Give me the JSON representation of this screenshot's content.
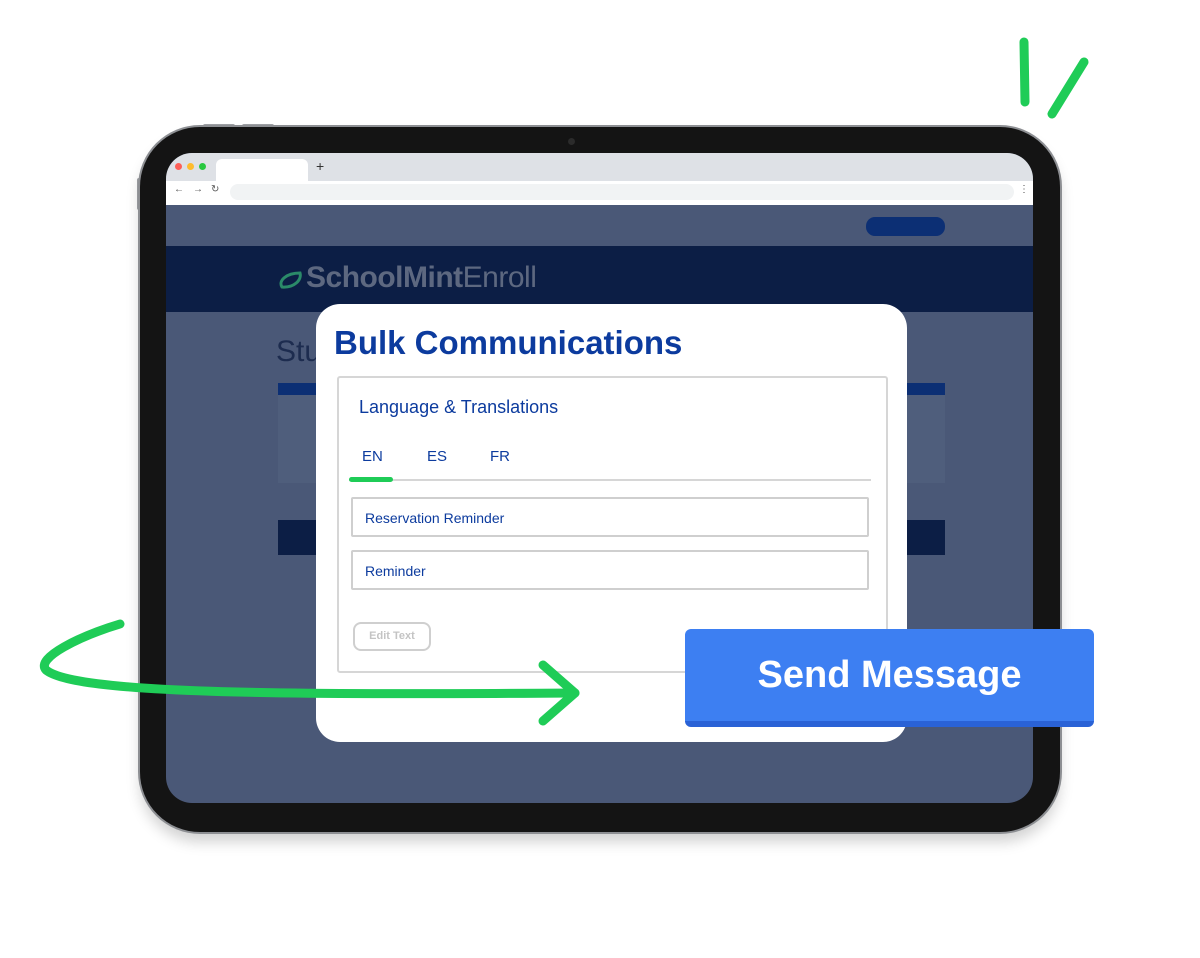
{
  "browser": {
    "new_tab": "+",
    "back": "←",
    "forward": "→",
    "reload": "↻",
    "menu": "⋮"
  },
  "app": {
    "logo_bold": "SchoolMint",
    "logo_light": "Enroll",
    "page_heading_partial": "Stu"
  },
  "modal": {
    "title": "Bulk Communications",
    "section_title": "Language & Translations",
    "tabs": [
      {
        "label": "EN",
        "active": true
      },
      {
        "label": "ES",
        "active": false
      },
      {
        "label": "FR",
        "active": false
      }
    ],
    "fields": [
      {
        "value": "Reservation Reminder"
      },
      {
        "value": "Reminder"
      }
    ],
    "edit_button": "Edit Text"
  },
  "cta": {
    "send_label": "Send Message"
  },
  "colors": {
    "accent_green": "#1fcc57",
    "primary_blue": "#0c3b9e",
    "button_blue": "#3d7ff2",
    "overlay": "#4a5877",
    "header_navy": "#0c1e45"
  },
  "icons": [
    "leaf-logo-icon",
    "arrow-curve-icon",
    "sparkle-lines-icon"
  ]
}
